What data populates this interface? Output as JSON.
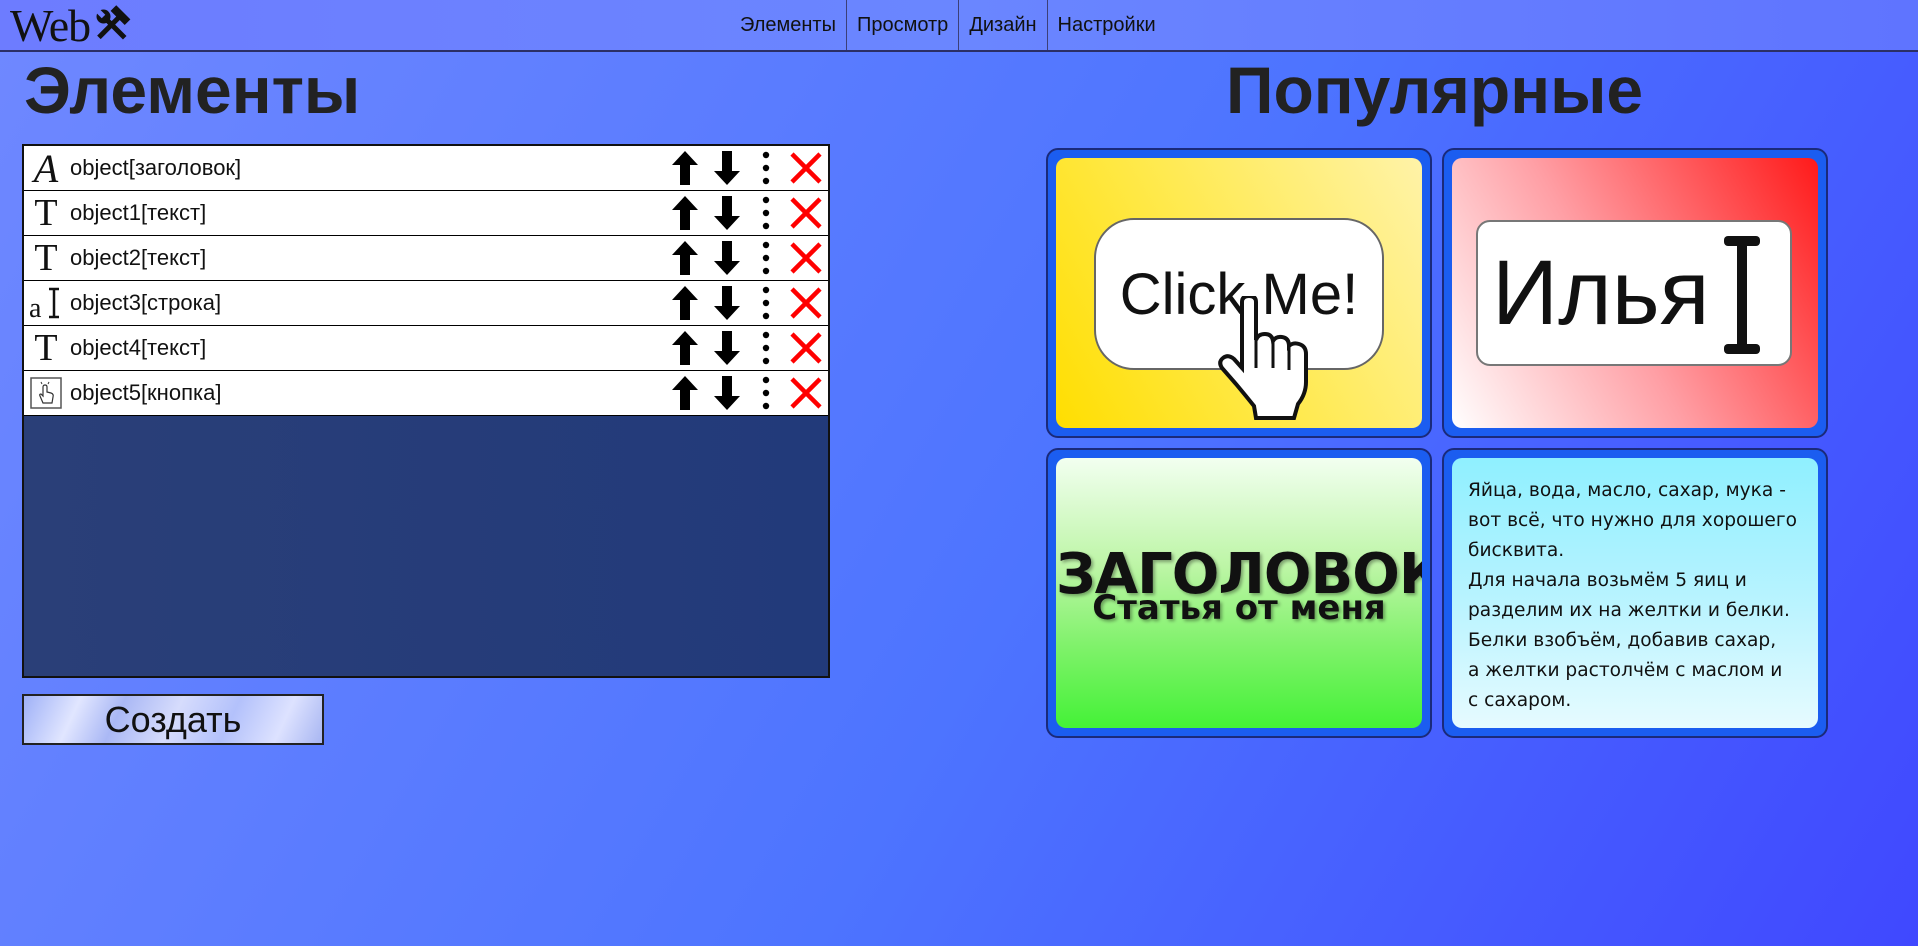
{
  "header": {
    "logo_text": "Web",
    "nav": [
      {
        "label": "Элементы"
      },
      {
        "label": "Просмотр"
      },
      {
        "label": "Дизайн"
      },
      {
        "label": "Настройки"
      }
    ]
  },
  "elements_panel": {
    "title": "Элементы",
    "items": [
      {
        "label": "object[заголовок]",
        "icon": "heading-icon"
      },
      {
        "label": "object1[текст]",
        "icon": "text-icon"
      },
      {
        "label": "object2[текст]",
        "icon": "text-icon"
      },
      {
        "label": "object3[строка]",
        "icon": "input-line-icon"
      },
      {
        "label": "object4[текст]",
        "icon": "text-icon"
      },
      {
        "label": "object5[кнопка]",
        "icon": "button-icon"
      }
    ],
    "row_actions": [
      "arrow-up-icon",
      "arrow-down-icon",
      "more-vertical-icon",
      "delete-icon"
    ],
    "create_label": "Создать"
  },
  "popular": {
    "title": "Популярные",
    "cards": {
      "button": {
        "text": "Click Me!"
      },
      "input": {
        "text": "Илья"
      },
      "heading": {
        "title": "ЗАГОЛОВОК",
        "subtitle": "Статья от меня"
      },
      "text": {
        "lines": [
          "Яйца, вода, масло, сахар, мука -",
          "вот всё, что нужно для хорошего",
          "бисквита.",
          "Для начала возьмём 5 яиц и",
          "разделим их на желтки и белки.",
          "Белки взобъём, добавив сахар,",
          "а желтки растолчём с маслом и",
          "с сахаром."
        ]
      }
    }
  },
  "colors": {
    "accent_card": "#1b5df0",
    "delete_red": "#ff0000"
  }
}
